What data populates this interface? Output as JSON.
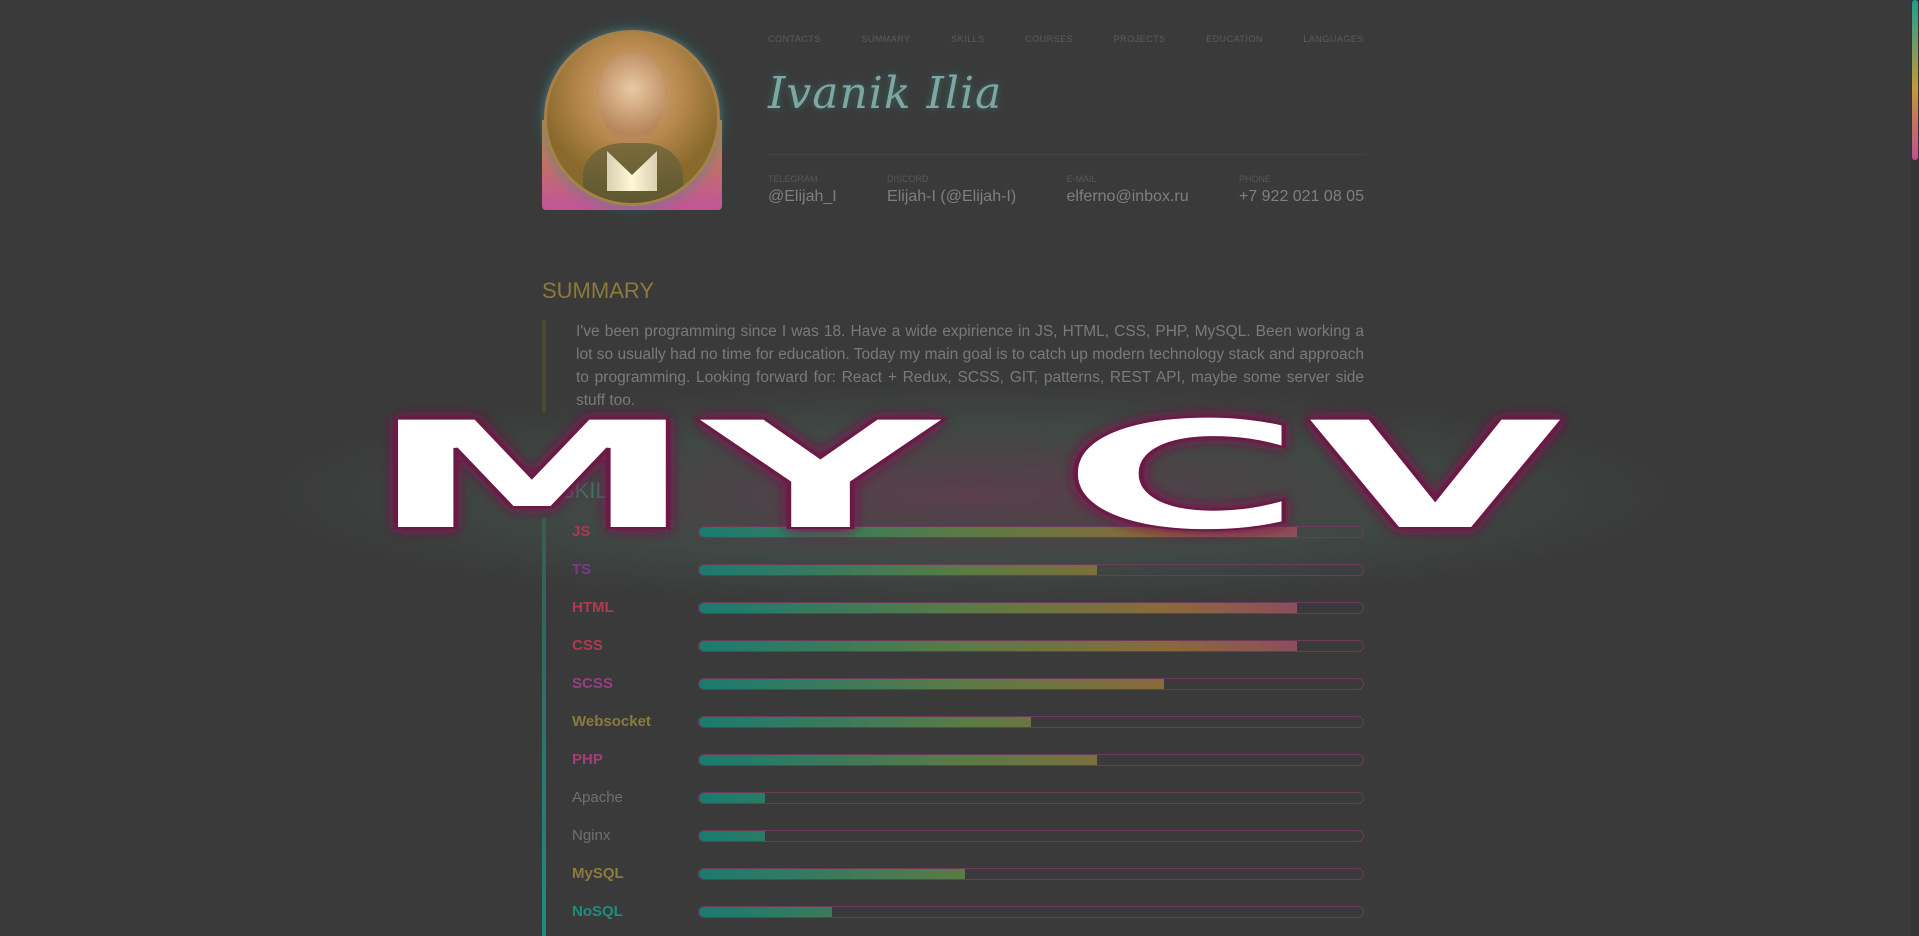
{
  "nav": [
    "CONTACTS",
    "SUMMARY",
    "SKILLS",
    "COURSES",
    "PROJECTS",
    "EDUCATION",
    "LANGUAGES"
  ],
  "profile": {
    "name": "Ivanik Ilia"
  },
  "contacts": [
    {
      "label": "TELEGRAM",
      "value": "@Elijah_I"
    },
    {
      "label": "DISCORD",
      "value": "Elijah-I (@Elijah-I)"
    },
    {
      "label": "E-MAIL",
      "value": "elferno@inbox.ru"
    },
    {
      "label": "PHONE",
      "value": "+7 922 021 08 05"
    }
  ],
  "summary": {
    "title": "SUMMARY",
    "text": "I've been programming since I was 18. Have a wide expirience in JS, HTML, CSS, PHP, MySQL. Been working a lot so usually had no time for education. Today my main goal is to catch up modern technology stack and approach to programming. Looking forward for: React + Redux, SCSS, GIT, patterns, REST API, maybe some server side stuff too."
  },
  "skills": {
    "title": "SKILLS",
    "items": [
      {
        "name": "JS",
        "level": 0.9,
        "color": "#b2364d"
      },
      {
        "name": "TS",
        "level": 0.6,
        "color": "#7b3a84"
      },
      {
        "name": "HTML",
        "level": 0.9,
        "color": "#b13950"
      },
      {
        "name": "CSS",
        "level": 0.9,
        "color": "#b13950"
      },
      {
        "name": "SCSS",
        "level": 0.7,
        "color": "#9a3d83"
      },
      {
        "name": "Websocket",
        "level": 0.5,
        "color": "#8a7a3c"
      },
      {
        "name": "PHP",
        "level": 0.6,
        "color": "#a23d7a"
      },
      {
        "name": "Apache",
        "level": 0.1,
        "color": "#6f6f6f"
      },
      {
        "name": "Nginx",
        "level": 0.1,
        "color": "#6f6f6f"
      },
      {
        "name": "MySQL",
        "level": 0.4,
        "color": "#8c7b3a"
      },
      {
        "name": "NoSQL",
        "level": 0.2,
        "color": "#1f8c80"
      }
    ]
  },
  "overlay": {
    "text": "MY CV"
  }
}
